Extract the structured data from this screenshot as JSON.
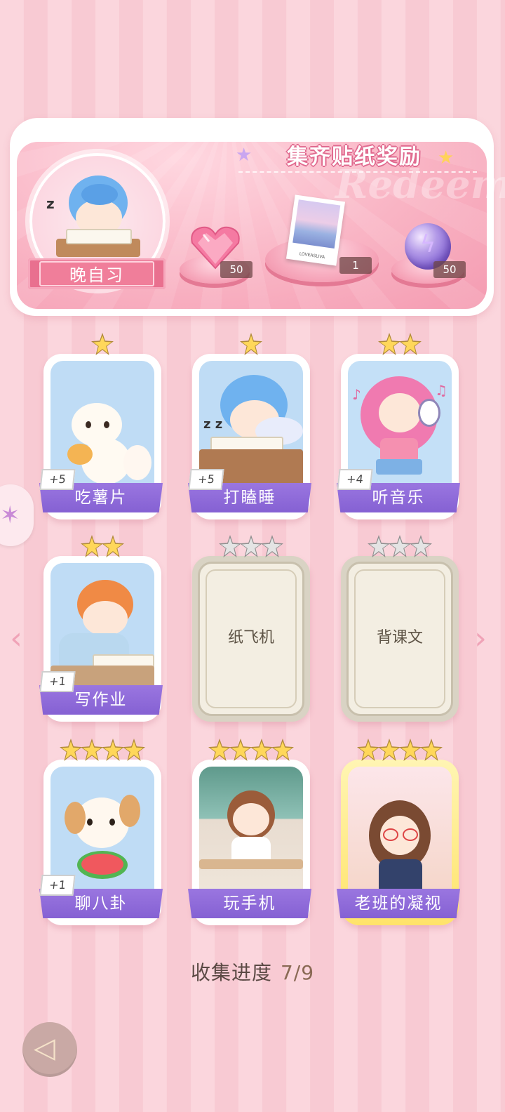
{
  "reward_panel": {
    "title": "集齐贴纸奖励",
    "watermark": "Redeem",
    "level_tag": "晚自习",
    "rewards": [
      {
        "icon": "pink-heart-gem-icon",
        "count": "50"
      },
      {
        "icon": "postcard-icon",
        "count": "1",
        "caption": "LOVEASLIVA"
      },
      {
        "icon": "purple-lightning-orb-icon",
        "count": "50"
      }
    ]
  },
  "cards": [
    {
      "name": "吃薯片",
      "stars": 1,
      "points": "+5",
      "state": "collected",
      "art": "white-cat-eating-chips"
    },
    {
      "name": "打瞌睡",
      "stars": 1,
      "points": "+5",
      "state": "collected",
      "art": "boy-sleeping-on-desk"
    },
    {
      "name": "听音乐",
      "stars": 2,
      "points": "+4",
      "state": "collected",
      "art": "girl-with-headphones"
    },
    {
      "name": "写作业",
      "stars": 2,
      "points": "+1",
      "state": "collected",
      "art": "boy-doing-homework"
    },
    {
      "name": "纸飞机",
      "stars": 3,
      "points": "",
      "state": "locked"
    },
    {
      "name": "背课文",
      "stars": 3,
      "points": "",
      "state": "locked"
    },
    {
      "name": "聊八卦",
      "stars": 4,
      "points": "+1",
      "state": "collected",
      "art": "dog-eating-watermelon"
    },
    {
      "name": "玩手机",
      "stars": 4,
      "points": "",
      "state": "collected",
      "art": "girl-playing-phone"
    },
    {
      "name": "老班的凝视",
      "stars": 4,
      "points": "",
      "state": "gold",
      "art": "teacher-with-glasses"
    }
  ],
  "progress": {
    "label": "收集进度",
    "value": "7/9"
  },
  "colors": {
    "accent": "#8561d3",
    "background": "#fbd6dd",
    "pink": "#e9708f",
    "star": "#ffd75a"
  }
}
